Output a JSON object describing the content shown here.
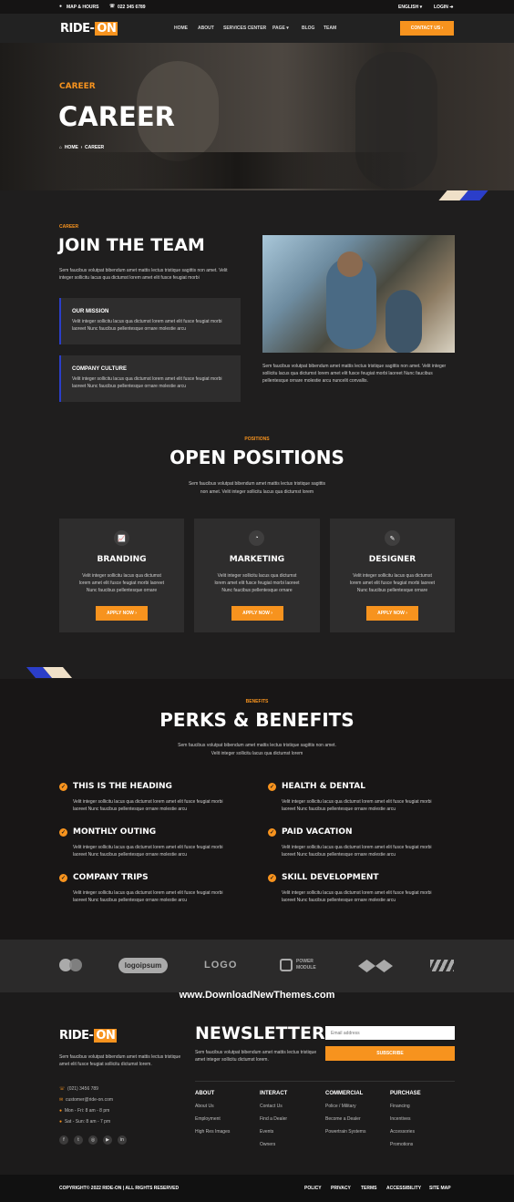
{
  "topbar": {
    "map": "MAP & HOURS",
    "phone": "022 345 6789",
    "language": "ENGLISH",
    "login": "LOGIN"
  },
  "logo": {
    "part1": "RIDE-",
    "part2": "ON"
  },
  "nav": {
    "items": [
      "HOME",
      "ABOUT",
      "SERVICES CENTER",
      "PAGE",
      "BLOG",
      "TEAM"
    ],
    "cta": "CONTACT US"
  },
  "hero": {
    "eyebrow": "CAREER",
    "title": "CAREER",
    "crumb_home": "HOME",
    "crumb_current": "CAREER"
  },
  "join": {
    "eyebrow": "CAREER",
    "title": "JOIN THE TEAM",
    "text": "Sem faucibus volutpat bibendum amet mattis lectus tristique sagittis non amet. Velit integer sollicitu lacus qua dictumst lorem amet elit fusce feugiat morbi",
    "mission_title": "OUR MISSION",
    "mission_text": "Velit integer sollicitu lacus qua dictumst lorem amet elit fusce feugiat morbi laoreet Nunc faucibus pellentesque ornare molestie arcu",
    "culture_title": "COMPANY CULTURE",
    "culture_text": "Velit integer sollicitu lacus qua dictumst lorem amet elit fusce feugiat morbi laoreet Nunc faucibus pellentesque ornare molestie arcu",
    "photo_text": "Sem faucibus volutpat bibendum amet mattis lectus tristique sagittis non amet. Velit integer sollicitu lacus qua dictumst lorem amet elit fusce feugiat morbi laoreet Nunc faucibus pellentesque ornare molestie arcu nuncelit convallis."
  },
  "positions": {
    "eyebrow": "POSITIONS",
    "title": "OPEN POSITIONS",
    "text1": "Sem faucibus volutpat bibendum amet mattis lectus tristique sagittis",
    "text2": "non amet. Velit integer sollicitu lacus qua dictumst lorem",
    "cards": [
      {
        "title": "BRANDING",
        "t1": "Velit integer sollicitu lacus qua dictumst",
        "t2": "lorem amet elit fusce feugiat morbi laoreet",
        "t3": "Nunc faucibus pellentesque ornare",
        "button": "APPLY NOW"
      },
      {
        "title": "MARKETING",
        "t1": "Velit integer sollicitu lacus qua dictumst",
        "t2": "lorem amet elit fusce feugiat morbi laoreet",
        "t3": "Nunc faucibus pellentesque ornare",
        "button": "APPLY NOW"
      },
      {
        "title": "DESIGNER",
        "t1": "Velit integer sollicitu lacus qua dictumst",
        "t2": "lorem amet elit fusce feugiat morbi laoreet",
        "t3": "Nunc faucibus pellentesque ornare",
        "button": "APPLY NOW"
      }
    ]
  },
  "benefits": {
    "eyebrow": "BENEFITS",
    "title": "PERKS & BENEFITS",
    "text1": "Sem faucibus volutpat bibendum amet mattis lectus tristique sagittis non amet.",
    "text2": "Velit integer sollicitu lacus qua dictumst lorem",
    "items": [
      {
        "title": "THIS IS THE HEADING",
        "t1": "Velit integer sollicitu lacus qua dictumst lorem amet elit fusce feugiat morbi",
        "t2": "laoreet Nunc faucibus pellentesque ornare molestie arcu"
      },
      {
        "title": "HEALTH & DENTAL",
        "t1": "Velit integer sollicitu lacus qua dictumst lorem amet elit fusce feugiat morbi",
        "t2": "laoreet Nunc faucibus pellentesque ornare molestie arcu"
      },
      {
        "title": "MONTHLY OUTING",
        "t1": "Velit integer sollicitu lacus qua dictumst lorem amet elit fusce feugiat morbi",
        "t2": "laoreet Nunc faucibus pellentesque ornare molestie arcu"
      },
      {
        "title": "PAID VACATION",
        "t1": "Velit integer sollicitu lacus qua dictumst lorem amet elit fusce feugiat morbi",
        "t2": "laoreet Nunc faucibus pellentesque ornare molestie arcu"
      },
      {
        "title": "COMPANY TRIPS",
        "t1": "Velit integer sollicitu lacus qua dictumst lorem amet elit fusce feugiat morbi",
        "t2": "laoreet Nunc faucibus pellentesque ornare molestie arcu"
      },
      {
        "title": "SKILL DEVELOPMENT",
        "t1": "Velit integer sollicitu lacus qua dictumst lorem amet elit fusce feugiat morbi",
        "t2": "laoreet Nunc faucibus pellentesque ornare molestie arcu"
      }
    ]
  },
  "brands": {
    "b2": "logoipsum",
    "b3": "LOGO",
    "b4a": "POWER",
    "b4b": "MODULE"
  },
  "watermark": "www.DownloadNewThemes.com",
  "footer": {
    "about": "Sem faucibus volutpat bibendum amet mattis lectus tristique amet elit fusce feugiat sollicitu dictumst lorem.",
    "phone": "(021) 3456 789",
    "email": "customer@ride-on.com",
    "hours1": "Mon - Fri: 8 am - 8 pm",
    "hours2": "Sat - Sun: 8 am - 7 pm",
    "newsletter_title": "NEWSLETTER",
    "newsletter_text": "Sem faucibus volutpat bibendum amet mattis lectus tristique amet integer sollicitu dictumst lorem.",
    "email_placeholder": "Email address",
    "subscribe": "SUBSCRIBE",
    "cols": [
      {
        "title": "ABOUT",
        "links": [
          "About Us",
          "Employment",
          "High Res Images"
        ]
      },
      {
        "title": "INTERACT",
        "links": [
          "Contact Us",
          "Find a Dealer",
          "Events",
          "Owners"
        ]
      },
      {
        "title": "COMMERCIAL",
        "links": [
          "Police / Military",
          "Become a Dealer",
          "Powertrain Systems"
        ]
      },
      {
        "title": "PURCHASE",
        "links": [
          "Financing",
          "Incentives",
          "Accessories",
          "Promotions"
        ]
      }
    ]
  },
  "bottom": {
    "copyright": "COPYRIGHT© 2022 RIDE-ON | ALL RIGHTS RESERVED",
    "links": [
      "POLICY",
      "PRIVACY",
      "TERMS",
      "ACCESSIBILITY",
      "SITE MAP"
    ]
  },
  "colors": {
    "accent": "#f7931e",
    "blue": "#2b3ec9"
  }
}
